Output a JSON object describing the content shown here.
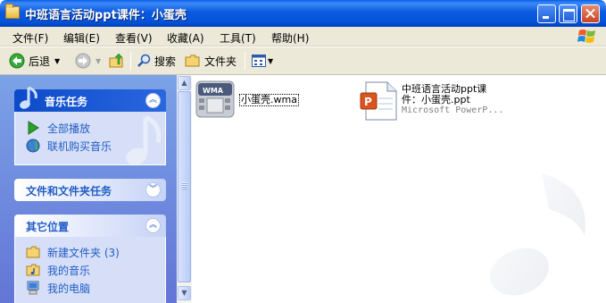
{
  "window": {
    "title": "中班语言活动ppt课件：小蛋壳"
  },
  "menu": [
    {
      "label": "文件(F)"
    },
    {
      "label": "编辑(E)"
    },
    {
      "label": "查看(V)"
    },
    {
      "label": "收藏(A)"
    },
    {
      "label": "工具(T)"
    },
    {
      "label": "帮助(H)"
    }
  ],
  "toolbar": {
    "back_label": "后退",
    "search_label": "搜索",
    "folders_label": "文件夹"
  },
  "sidebar": {
    "music_tasks": {
      "title": "音乐任务",
      "items": [
        {
          "label": "全部播放",
          "icon": "play-icon"
        },
        {
          "label": "联机购买音乐",
          "icon": "globe-icon"
        }
      ]
    },
    "file_folder_tasks": {
      "title": "文件和文件夹任务"
    },
    "other_places": {
      "title": "其它位置",
      "items": [
        {
          "label": "新建文件夹 (3)",
          "icon": "folder-icon"
        },
        {
          "label": "我的音乐",
          "icon": "music-folder-icon"
        },
        {
          "label": "我的电脑",
          "icon": "computer-icon"
        }
      ]
    }
  },
  "files": [
    {
      "name": "小蛋壳.wma",
      "type": "wma",
      "badge": "WMA"
    },
    {
      "name_line1": "中班语言活动ppt课",
      "name_line2": "件：小蛋壳.ppt",
      "subtitle": "Microsoft PowerP...",
      "type": "ppt"
    }
  ],
  "colors": {
    "title_bar": "#0a5ee8",
    "sidebar_bg": "#7ba2e7",
    "link_text": "#215dc6",
    "chrome": "#ece9d8"
  }
}
